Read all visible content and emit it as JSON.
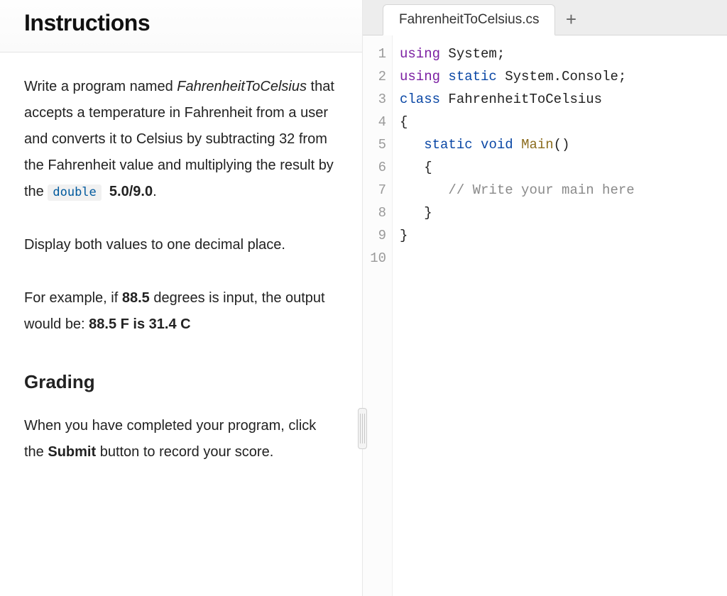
{
  "left": {
    "title": "Instructions",
    "para1_prefix": "Write a program named ",
    "para1_program_name": "FahrenheitToCelsius",
    "para1_mid": " that accepts a temperature in Fahrenheit from a user and converts it to Celsius by subtracting 32 from the Fahrenheit value and multiplying the result by the ",
    "para1_code_chip": "double",
    "para1_bold_tail": "5.0/9.0",
    "para1_period": ".",
    "para2": "Display both values to one decimal place.",
    "para3_prefix": "For example, if ",
    "para3_input_value": "88.5",
    "para3_mid": " degrees is input, the output would be: ",
    "para3_output": "88.5 F is 31.4 C",
    "grading_heading": "Grading",
    "grading_prefix": "When you have completed your program, click the ",
    "grading_bold": "Submit",
    "grading_suffix": " button to record your score."
  },
  "tabs": {
    "active": "FahrenheitToCelsius.cs",
    "add_label": "+"
  },
  "code": {
    "lines": [
      {
        "n": "1",
        "tokens": [
          [
            "kw-using",
            "using"
          ],
          [
            "sp",
            " "
          ],
          [
            "ident",
            "System"
          ],
          [
            "punct",
            ";"
          ]
        ]
      },
      {
        "n": "2",
        "tokens": [
          [
            "kw-using",
            "using"
          ],
          [
            "sp",
            " "
          ],
          [
            "kw-static",
            "static"
          ],
          [
            "sp",
            " "
          ],
          [
            "ident",
            "System.Console"
          ],
          [
            "punct",
            ";"
          ]
        ]
      },
      {
        "n": "3",
        "tokens": [
          [
            "kw-class",
            "class"
          ],
          [
            "sp",
            " "
          ],
          [
            "ident",
            "FahrenheitToCelsius"
          ]
        ]
      },
      {
        "n": "4",
        "tokens": [
          [
            "punct",
            "{"
          ]
        ]
      },
      {
        "n": "5",
        "tokens": [
          [
            "sp",
            "   "
          ],
          [
            "kw-static",
            "static"
          ],
          [
            "sp",
            " "
          ],
          [
            "kw-void",
            "void"
          ],
          [
            "sp",
            " "
          ],
          [
            "fn",
            "Main"
          ],
          [
            "punct",
            "()"
          ]
        ]
      },
      {
        "n": "6",
        "tokens": [
          [
            "sp",
            "   "
          ],
          [
            "punct",
            "{"
          ]
        ]
      },
      {
        "n": "7",
        "tokens": [
          [
            "sp",
            "      "
          ],
          [
            "cmt",
            "// Write your main here"
          ]
        ]
      },
      {
        "n": "8",
        "tokens": [
          [
            "sp",
            "   "
          ],
          [
            "punct",
            "}"
          ]
        ]
      },
      {
        "n": "9",
        "tokens": [
          [
            "punct",
            "}"
          ]
        ]
      },
      {
        "n": "10",
        "tokens": []
      }
    ]
  }
}
